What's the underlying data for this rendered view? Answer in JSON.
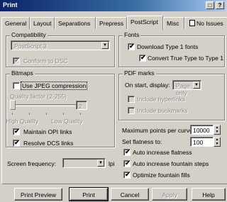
{
  "window": {
    "title": "Print",
    "help_glyph": "?",
    "max_glyph": "□"
  },
  "tabs": [
    {
      "label": "General"
    },
    {
      "label": "Layout"
    },
    {
      "label": "Separations"
    },
    {
      "label": "Prepress"
    },
    {
      "label": "PostScript",
      "active": true
    },
    {
      "label": "Misc"
    },
    {
      "label": "No Issues",
      "icon": "warning-page-icon"
    }
  ],
  "compatibility": {
    "group_label": "Compatibility",
    "level_value": "PostScript 3",
    "conform_dsc_label": "Conform to DSC",
    "conform_dsc_checked": true
  },
  "fonts": {
    "group_label": "Fonts",
    "download_type1_label": "Download Type 1 fonts",
    "download_type1_checked": true,
    "convert_tt_label": "Convert True Type to Type 1",
    "convert_tt_checked": true
  },
  "bitmaps": {
    "group_label": "Bitmaps",
    "use_jpeg_label": "Use JPEG compression",
    "use_jpeg_checked": false,
    "quality_label": "Quality factor (2-255)",
    "quality_value": "2",
    "high_quality_label": "High Quality",
    "low_quality_label": "Low Quality",
    "maintain_opi_label": "Maintain OPI links",
    "maintain_opi_checked": true,
    "resolve_dcs_label": "Resolve DCS links",
    "resolve_dcs_checked": true
  },
  "pdf_marks": {
    "group_label": "PDF marks",
    "on_start_label": "On start, display:",
    "on_start_value": "Page only",
    "include_hyperlinks_label": "Include hyperlinks",
    "include_bookmarks_label": "Include bookmarks"
  },
  "curves": {
    "max_points_label": "Maximum points per curve:",
    "max_points_value": "10000",
    "flatness_label": "Set flatness to:",
    "flatness_value": "100",
    "auto_flatness_label": "Auto increase flatness",
    "auto_flatness_checked": true,
    "auto_fountain_label": "Auto increase fountain steps",
    "auto_fountain_checked": true,
    "optimize_fountain_label": "Optimize fountain fills",
    "optimize_fountain_checked": true
  },
  "screen": {
    "label": "Screen frequency:",
    "value": "",
    "unit": "lpi"
  },
  "buttons": {
    "print_preview": "Print Preview",
    "print": "Print",
    "cancel": "Cancel",
    "apply": "Apply",
    "help": "Help"
  }
}
